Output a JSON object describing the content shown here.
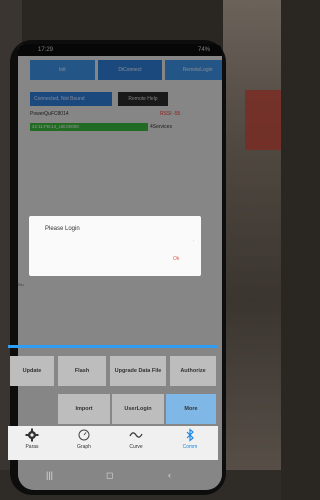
{
  "status_bar": {
    "time": "17:29",
    "battery": "74%"
  },
  "tabs": [
    {
      "label": "Init"
    },
    {
      "label": "DiConnect"
    },
    {
      "label": "RemoteLogin"
    }
  ],
  "connection": {
    "status_label": "Connected, Not Bound",
    "remote_help_label": "Remote Help"
  },
  "device": {
    "name": "PowerQuFC8014",
    "rssi": "RSSI -55",
    "bar_text": "42:11:FB:14_UB:00000",
    "services": "4Services"
  },
  "dialog": {
    "title": "Please Login",
    "ok_label": "Ok"
  },
  "partial_text": "Blu",
  "grid": {
    "row1": [
      "Update",
      "Flash",
      "Upgrade Data File",
      "Authorize"
    ],
    "row2": [
      "Import",
      "UserLogin",
      "More"
    ]
  },
  "bottom_nav": [
    {
      "label": "Paras"
    },
    {
      "label": "Graph"
    },
    {
      "label": "Curve"
    },
    {
      "label": "Comm"
    }
  ],
  "accent_colors": {
    "blue": "#2f7fd9",
    "ok_red": "#e35a4a",
    "green": "#3cb83c"
  }
}
